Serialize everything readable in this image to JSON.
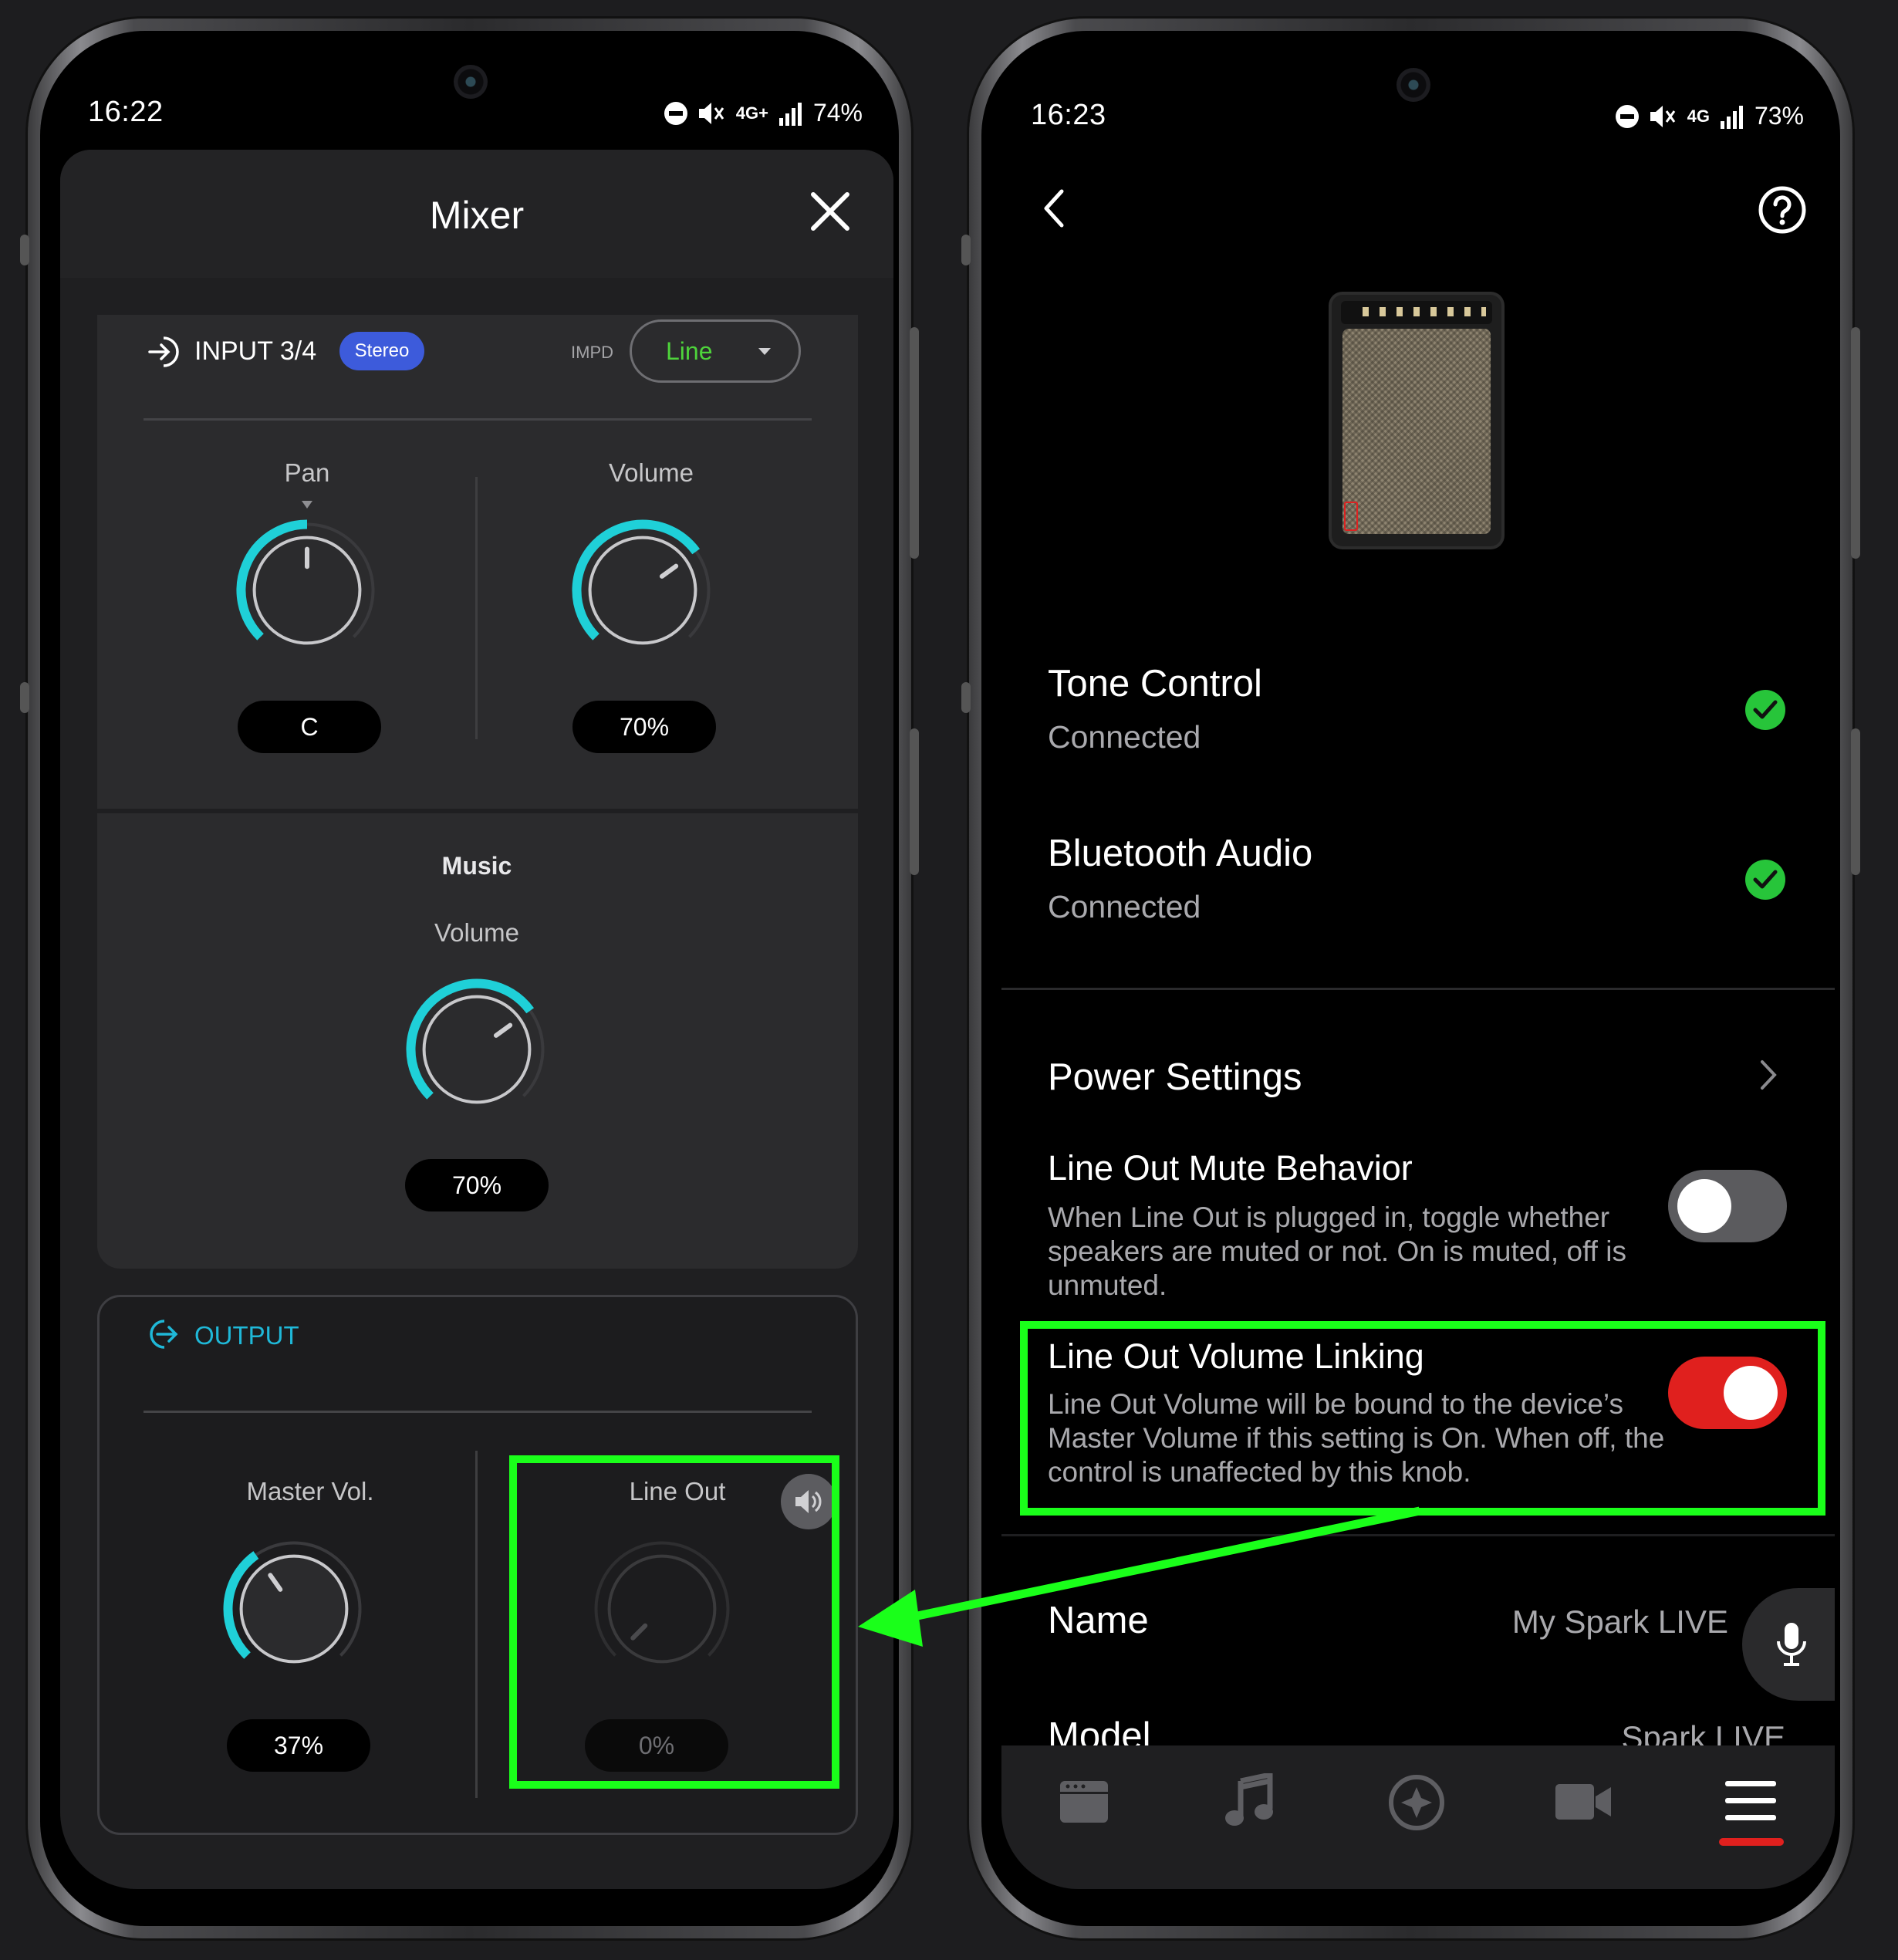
{
  "left_phone": {
    "status": {
      "time": "16:22",
      "network": "4G+",
      "battery": "74%"
    },
    "header": {
      "title": "Mixer"
    },
    "input": {
      "title": "INPUT 3/4",
      "badge": "Stereo",
      "impd_label": "IMPD",
      "impd_value": "Line",
      "pan": {
        "label": "Pan",
        "value": "C",
        "level": 0.5
      },
      "volume": {
        "label": "Volume",
        "value": "70%",
        "level": 0.7
      }
    },
    "music": {
      "title": "Music",
      "volume": {
        "label": "Volume",
        "value": "70%",
        "level": 0.7
      }
    },
    "output": {
      "title": "OUTPUT",
      "master": {
        "label": "Master Vol.",
        "value": "37%",
        "level": 0.37
      },
      "line_out": {
        "label": "Line Out",
        "value": "0%",
        "level": 0.0
      }
    }
  },
  "right_phone": {
    "status": {
      "time": "16:23",
      "network": "4G",
      "battery": "73%"
    },
    "connections": [
      {
        "title": "Tone Control",
        "status": "Connected"
      },
      {
        "title": "Bluetooth Audio",
        "status": "Connected"
      }
    ],
    "power_settings": {
      "title": "Power Settings"
    },
    "line_out_mute": {
      "title": "Line Out Mute Behavior",
      "desc_1": "When Line Out is plugged in, toggle whether",
      "desc_2": "speakers are muted or not. On is muted, off is",
      "desc_3": "unmuted.",
      "enabled": false
    },
    "line_out_linking": {
      "title": "Line Out Volume Linking",
      "desc_1": "Line Out Volume will be bound to the device’s",
      "desc_2": "Master Volume if this setting is On. When off, the",
      "desc_3": "control is unaffected by this knob.",
      "enabled": true
    },
    "name": {
      "label": "Name",
      "value": "My Spark LIVE"
    },
    "model": {
      "label": "Model",
      "value": "Spark LIVE"
    }
  },
  "colors": {
    "accent_cyan": "#1fd0d8",
    "highlight_green": "#1aff1a",
    "toggle_on": "#e0201e",
    "toggle_off": "#5b5b5e",
    "badge_blue": "#3d5bdb",
    "impd_green": "#4ed43b",
    "check_green": "#27c53a",
    "nav_active": "#e0201e"
  }
}
